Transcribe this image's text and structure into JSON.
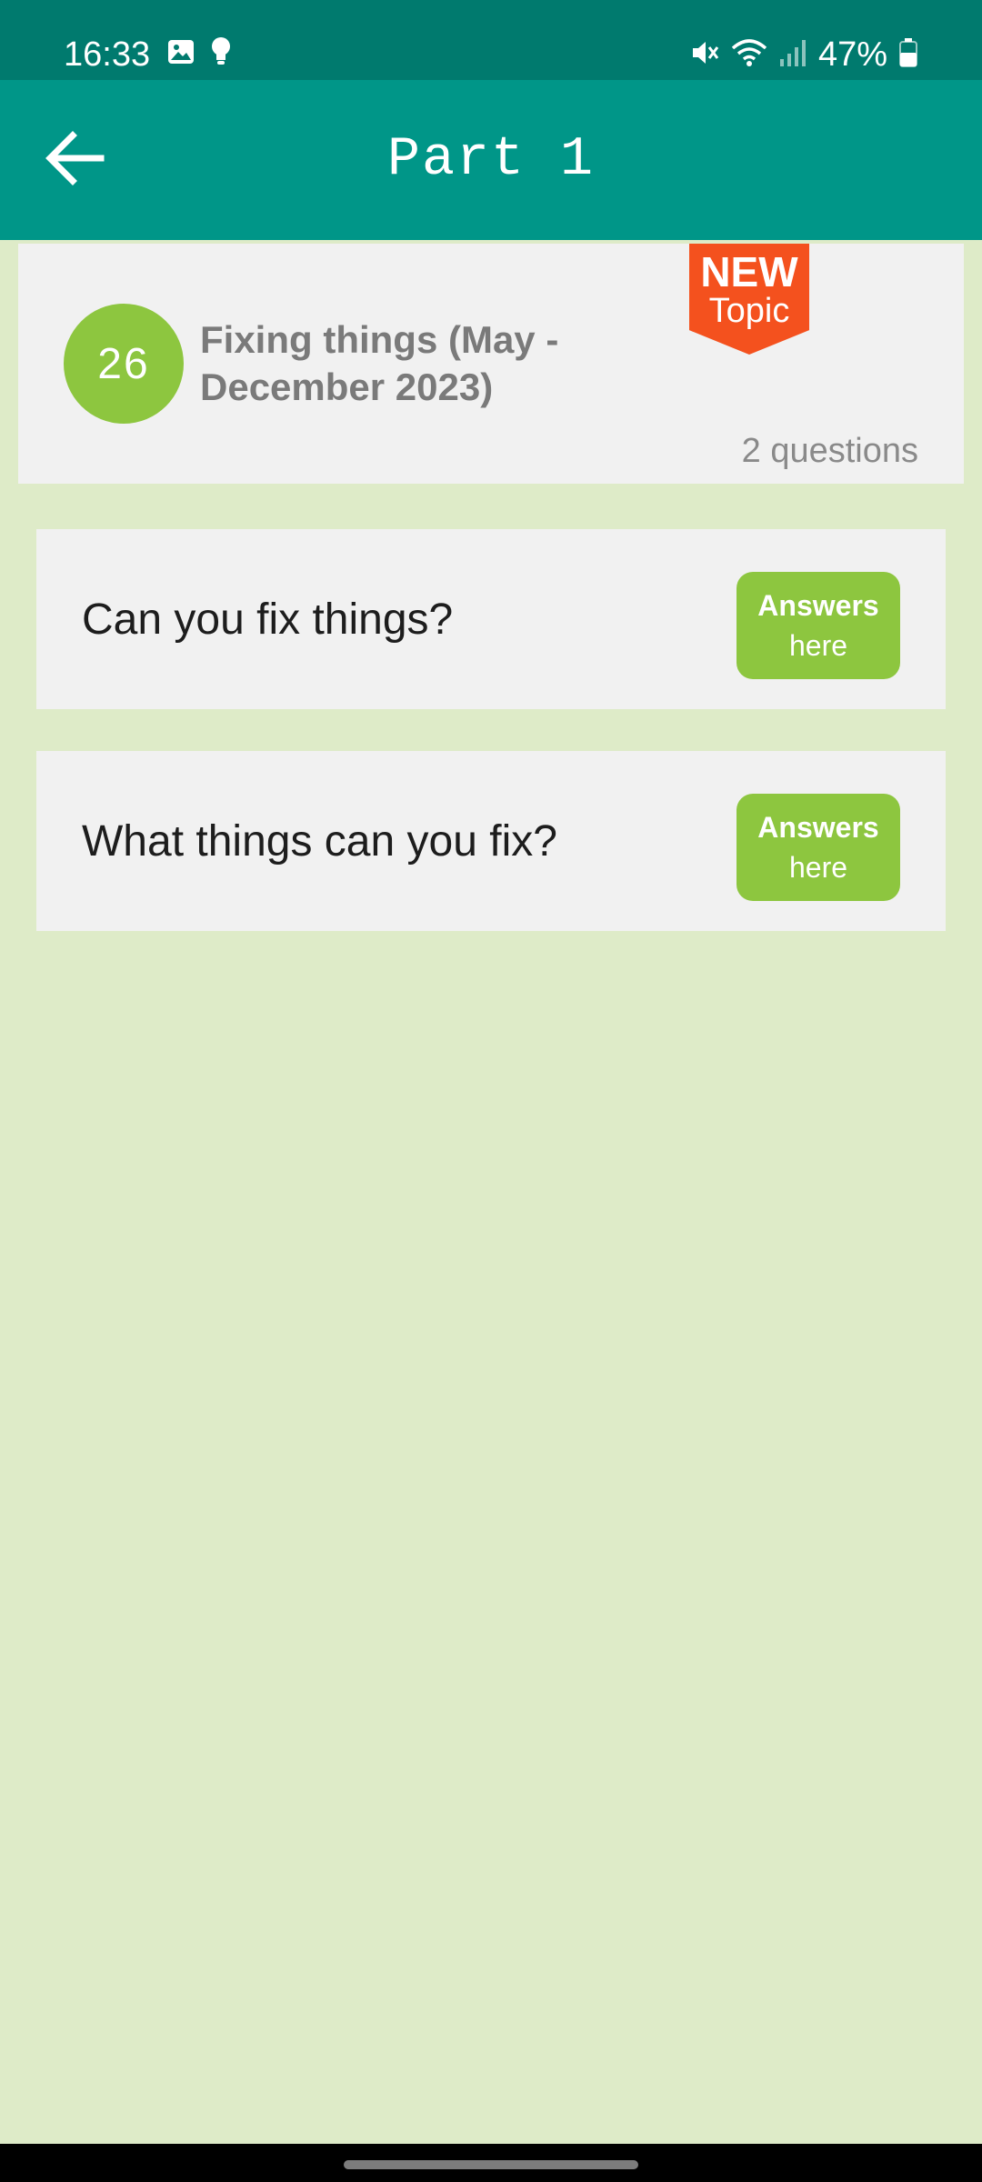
{
  "status_bar": {
    "time": "16:33",
    "battery": "47%",
    "left_icons": [
      "gallery-icon",
      "bulb-icon"
    ],
    "right_icons": [
      "mute-icon",
      "wifi-icon",
      "signal-icon",
      "battery-icon"
    ]
  },
  "app_bar": {
    "title": "Part 1",
    "back_icon": "arrow-left-icon"
  },
  "topic": {
    "number": "26",
    "title": "Fixing things (May - December 2023)",
    "count": "2 questions",
    "badge_line1": "NEW",
    "badge_line2": "Topic"
  },
  "questions": [
    {
      "text": "Can you fix things?",
      "button_line1": "Answers",
      "button_line2": "here"
    },
    {
      "text": "What things can you fix?",
      "button_line1": "Answers",
      "button_line2": "here"
    }
  ],
  "colors": {
    "status_bar": "#007a6e",
    "app_bar": "#009688",
    "background": "#deebc8",
    "card": "#f1f1f1",
    "accent_green": "#8dc63f",
    "badge_orange": "#f4511e"
  }
}
